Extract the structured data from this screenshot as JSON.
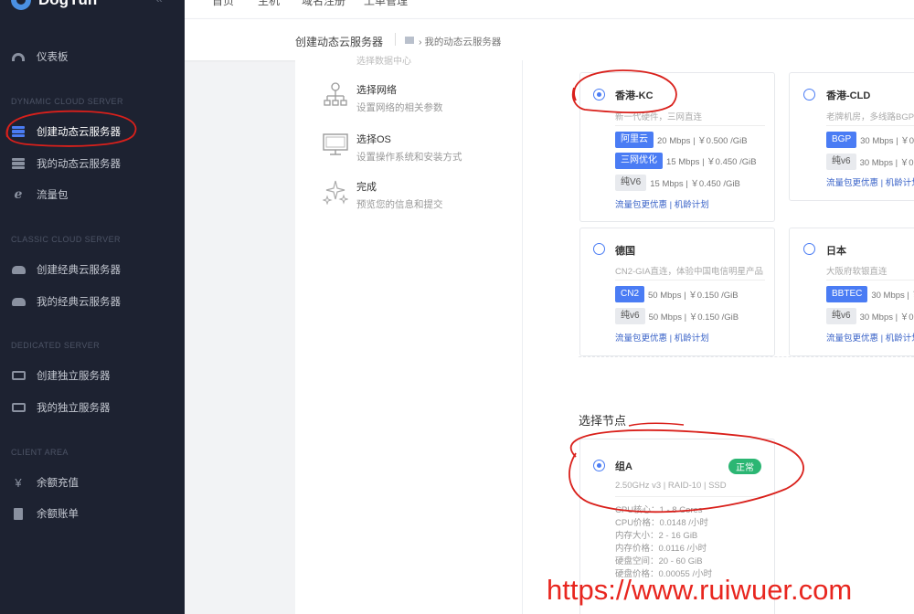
{
  "brand": {
    "name": "DogYun"
  },
  "topbar": {
    "fragments": [
      "首页",
      "主机",
      "域名注册",
      "工单管理"
    ]
  },
  "sidebar": {
    "dashboard": "仪表板",
    "sections": [
      "DYNAMIC CLOUD SERVER",
      "CLASSIC CLOUD SERVER",
      "DEDICATED SERVER",
      "CLIENT AREA"
    ],
    "items": [
      "创建动态云服务器",
      "我的动态云服务器",
      "流量包",
      "创建经典云服务器",
      "我的经典云服务器",
      "创建独立服务器",
      "我的独立服务器",
      "余额充值",
      "余额账单"
    ]
  },
  "breadcrumb": {
    "title": "创建动态云服务器",
    "current": "我的动态云服务器"
  },
  "steps": {
    "cut": "选择数据中心",
    "network": {
      "title": "选择网络",
      "desc": "设置网络的相关参数"
    },
    "os": {
      "title": "选择OS",
      "desc": "设置操作系统和安装方式"
    },
    "done": {
      "title": "完成",
      "desc": "预览您的信息和提交"
    }
  },
  "regions": [
    {
      "name": "香港-KC",
      "selected": true,
      "desc": "新一代硬件，三网直连",
      "bandwidth": [
        {
          "tag": "阿里云",
          "style": "blue",
          "value": "20 Mbps | ￥0.500 /GiB"
        },
        {
          "tag": "三网优化",
          "style": "blue",
          "value": "15 Mbps | ￥0.450 /GiB"
        },
        {
          "tag": "纯V6",
          "style": "grey",
          "value": "15 Mbps | ￥0.450 /GiB"
        }
      ],
      "link": "流量包更优惠 | 机龄计划"
    },
    {
      "name": "香港-CLD",
      "selected": false,
      "desc": "老牌机房，多线路BGP优化",
      "bandwidth": [
        {
          "tag": "BGP",
          "style": "blue",
          "value": "30 Mbps | ￥0.2"
        },
        {
          "tag": "纯v6",
          "style": "grey",
          "value": "30 Mbps | ￥0.2"
        }
      ],
      "link": "流量包更优惠 | 机龄计划"
    },
    {
      "name": "德国",
      "selected": false,
      "desc": "CN2-GIA直连，体验中国电信明星产品",
      "bandwidth": [
        {
          "tag": "CN2",
          "style": "blue",
          "value": "50 Mbps | ￥0.150 /GiB"
        },
        {
          "tag": "纯v6",
          "style": "grey",
          "value": "50 Mbps | ￥0.150 /GiB"
        }
      ],
      "link": "流量包更优惠 | 机龄计划"
    },
    {
      "name": "日本",
      "selected": false,
      "desc": "大阪府软银直连",
      "bandwidth": [
        {
          "tag": "BBTEC",
          "style": "blue",
          "value": "30 Mbps | ￥"
        },
        {
          "tag": "纯v6",
          "style": "grey",
          "value": "30 Mbps | ￥0.2"
        }
      ],
      "link": "流量包更优惠 | 机龄计划"
    }
  ],
  "node_section": {
    "title": "选择节点"
  },
  "node": {
    "name": "组A",
    "status": "正常",
    "spec": "2.50GHz v3 | RAID-10 | SSD",
    "details": [
      "CPU核心：1 - 8 Cores",
      "CPU价格：0.0148 /小时",
      "内存大小：2 - 16 GiB",
      "内存价格：0.0116 /小时",
      "硬盘空间：20 - 60 GiB",
      "硬盘价格：0.00055 /小时"
    ]
  },
  "watermark": "https://www.ruiwuer.com",
  "colors": {
    "accent": "#4a7cf4",
    "sidebar": "#1d2231",
    "success": "#2bb673",
    "annotation": "#d9201b"
  }
}
